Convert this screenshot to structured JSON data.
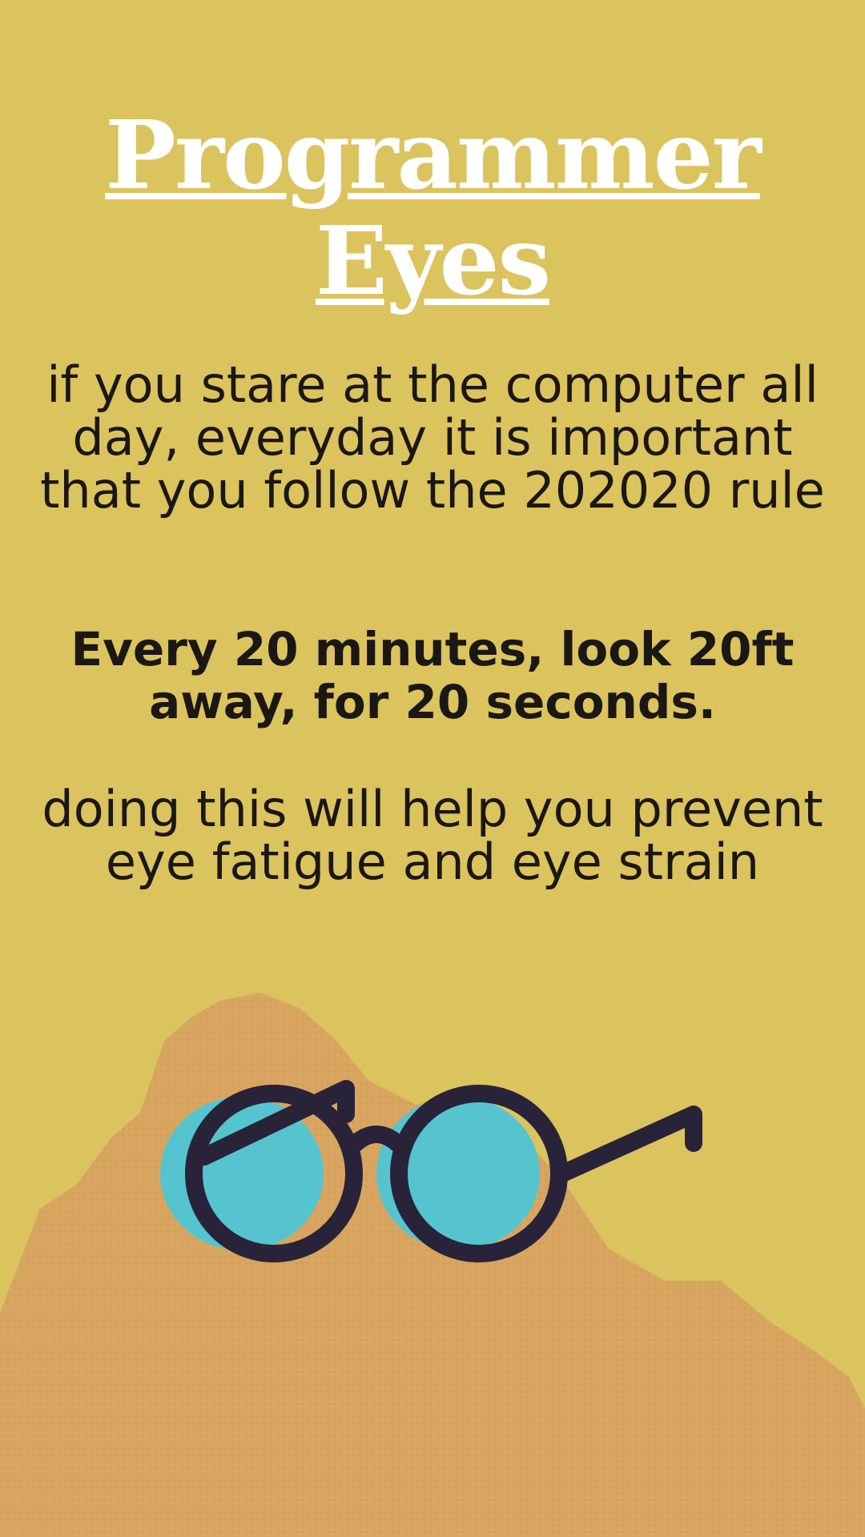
{
  "poster": {
    "title_line1": "Programmer",
    "title_line2": "Eyes",
    "intro_text": "if you stare at the computer all day, everyday it is important that you follow the 202020 rule",
    "rule_text": "Every 20 minutes, look 20ft away, for 20 seconds.",
    "benefit_text": "doing this will help you prevent eye fatigue and eye strain"
  },
  "colors": {
    "background": "#dbc35e",
    "mountain": "#d8a560",
    "title_text": "#ffffff",
    "body_text": "#1b1714",
    "glasses_frame": "#29233a",
    "lens_fill": "#55c4cf"
  },
  "icons": {
    "illustration": "eyeglasses-icon",
    "background_shape": "mountain-shape"
  }
}
